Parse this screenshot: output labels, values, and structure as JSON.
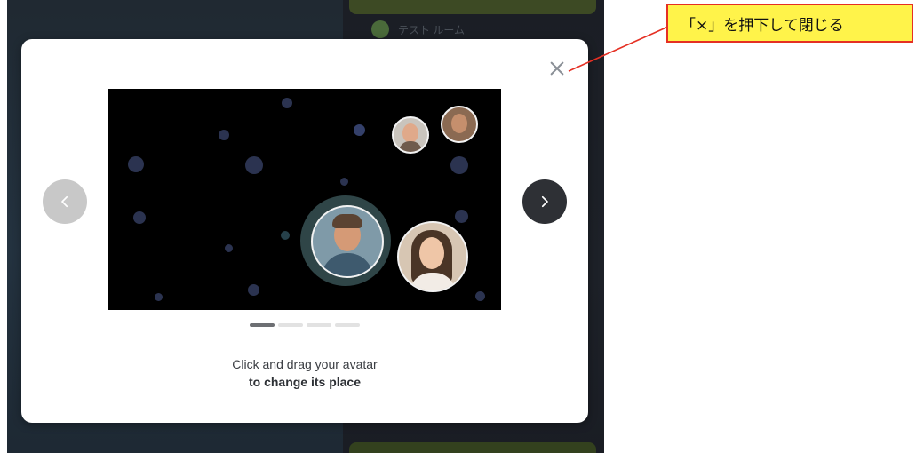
{
  "background": {
    "ghost_item_text": "テスト ルーム"
  },
  "modal": {
    "caption_line1": "Click and drag your avatar",
    "caption_line2": "to change its place",
    "pager_total": 4,
    "pager_active": 1
  },
  "annotation": {
    "text": "「×」を押下して閉じる",
    "border_color": "#e53024",
    "fill_color": "#fff34a"
  },
  "icons": {
    "close": "close-icon",
    "prev": "chevron-left-icon",
    "next": "chevron-right-icon"
  }
}
